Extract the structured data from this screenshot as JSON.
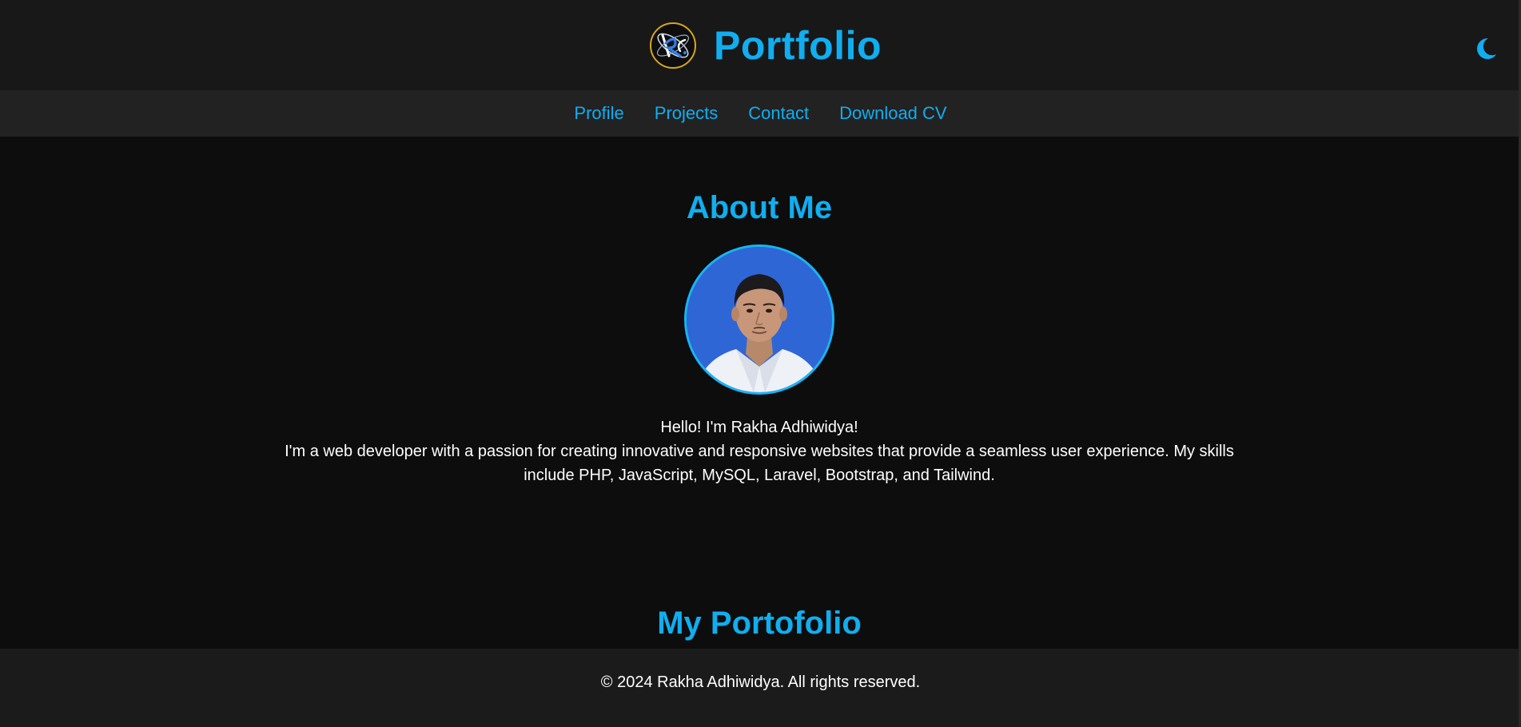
{
  "header": {
    "logo_icon": "rk-monogram-logo",
    "title": "Portfolio",
    "theme_toggle_icon": "moon-icon"
  },
  "nav": {
    "items": [
      {
        "label": "Profile"
      },
      {
        "label": "Projects"
      },
      {
        "label": "Contact"
      },
      {
        "label": "Download CV"
      }
    ]
  },
  "about": {
    "title": "About Me",
    "greeting": "Hello! I'm Rakha Adhiwidya!",
    "description": "I'm a web developer with a passion for creating innovative and responsive websites that provide a seamless user experience. My skills include PHP, JavaScript, MySQL, Laravel, Bootstrap, and Tailwind."
  },
  "portfolio": {
    "title": "My Portofolio"
  },
  "footer": {
    "text": "© 2024 Rakha Adhiwidya. All rights reserved."
  },
  "colors": {
    "accent": "#10aef0",
    "header_bg": "#181818",
    "nav_bg": "#222222",
    "body_bg": "#0d0d0d",
    "footer_bg": "#1b1b1b",
    "logo_ring": "#d9a520"
  }
}
